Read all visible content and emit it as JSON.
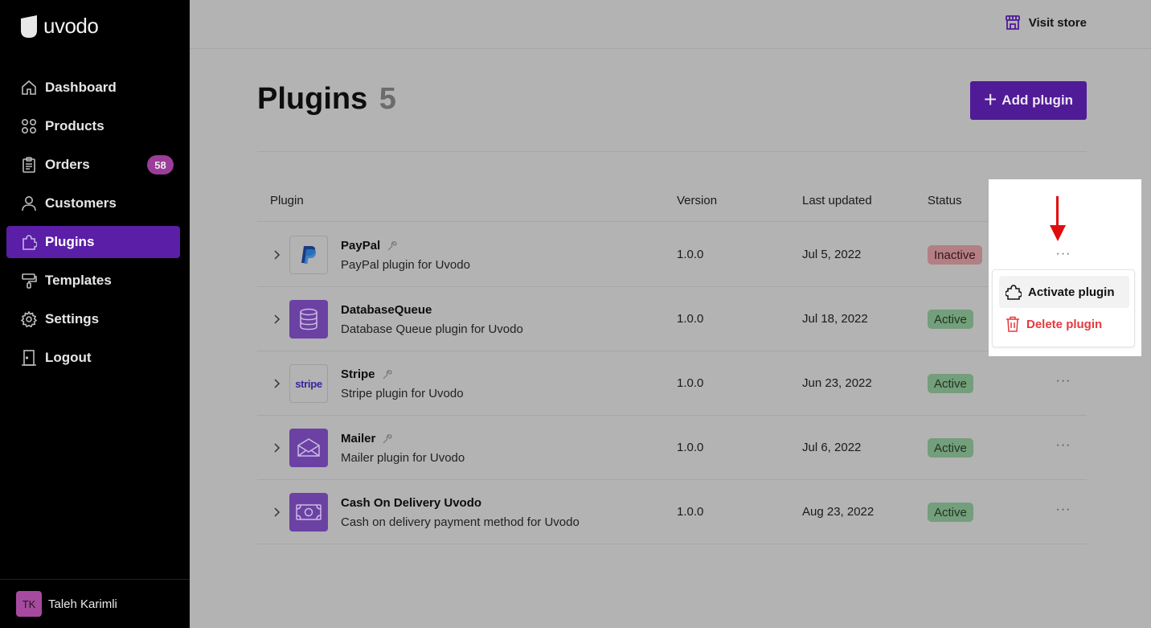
{
  "app": {
    "name": "uvodo"
  },
  "sidebar": {
    "items": [
      {
        "label": "Dashboard",
        "icon": "home-icon"
      },
      {
        "label": "Products",
        "icon": "grid-icon"
      },
      {
        "label": "Orders",
        "icon": "clipboard-icon",
        "badge": "58"
      },
      {
        "label": "Customers",
        "icon": "user-icon"
      },
      {
        "label": "Plugins",
        "icon": "puzzle-icon",
        "active": true
      },
      {
        "label": "Templates",
        "icon": "paint-roller-icon"
      },
      {
        "label": "Settings",
        "icon": "gear-icon"
      },
      {
        "label": "Logout",
        "icon": "door-icon"
      }
    ],
    "user": {
      "initials": "TK",
      "name": "Taleh Karimli"
    }
  },
  "topbar": {
    "visit_store": "Visit store"
  },
  "header": {
    "title": "Plugins",
    "count": "5",
    "add_button": "Add plugin"
  },
  "table": {
    "headers": {
      "plugin": "Plugin",
      "version": "Version",
      "last_updated": "Last updated",
      "status": "Status"
    },
    "rows": [
      {
        "name": "PayPal",
        "description": "PayPal plugin for Uvodo",
        "version": "1.0.0",
        "updated": "Jul 5, 2022",
        "status": "Inactive",
        "icon": "paypal-logo-icon",
        "wrench": true
      },
      {
        "name": "DatabaseQueue",
        "description": "Database Queue plugin for Uvodo",
        "version": "1.0.0",
        "updated": "Jul 18, 2022",
        "status": "Active",
        "icon": "database-icon",
        "wrench": false
      },
      {
        "name": "Stripe",
        "description": "Stripe plugin for Uvodo",
        "version": "1.0.0",
        "updated": "Jun 23, 2022",
        "status": "Active",
        "icon": "stripe-logo-icon",
        "wrench": true
      },
      {
        "name": "Mailer",
        "description": "Mailer plugin for Uvodo",
        "version": "1.0.0",
        "updated": "Jul 6, 2022",
        "status": "Active",
        "icon": "envelope-icon",
        "wrench": true
      },
      {
        "name": "Cash On Delivery Uvodo",
        "description": "Cash on delivery payment method for Uvodo",
        "version": "1.0.0",
        "updated": "Aug 23, 2022",
        "status": "Active",
        "icon": "cash-icon",
        "wrench": false
      }
    ]
  },
  "stripe_logo_text": "stripe",
  "row_actions_label": "···",
  "context_menu": {
    "activate": "Activate plugin",
    "delete": "Delete plugin"
  },
  "colors": {
    "accent": "#5a1ea7",
    "active_status": "#749e7c",
    "inactive_status": "#b27f85",
    "danger": "#e5393f",
    "annotation_arrow": "#e10d0d"
  }
}
